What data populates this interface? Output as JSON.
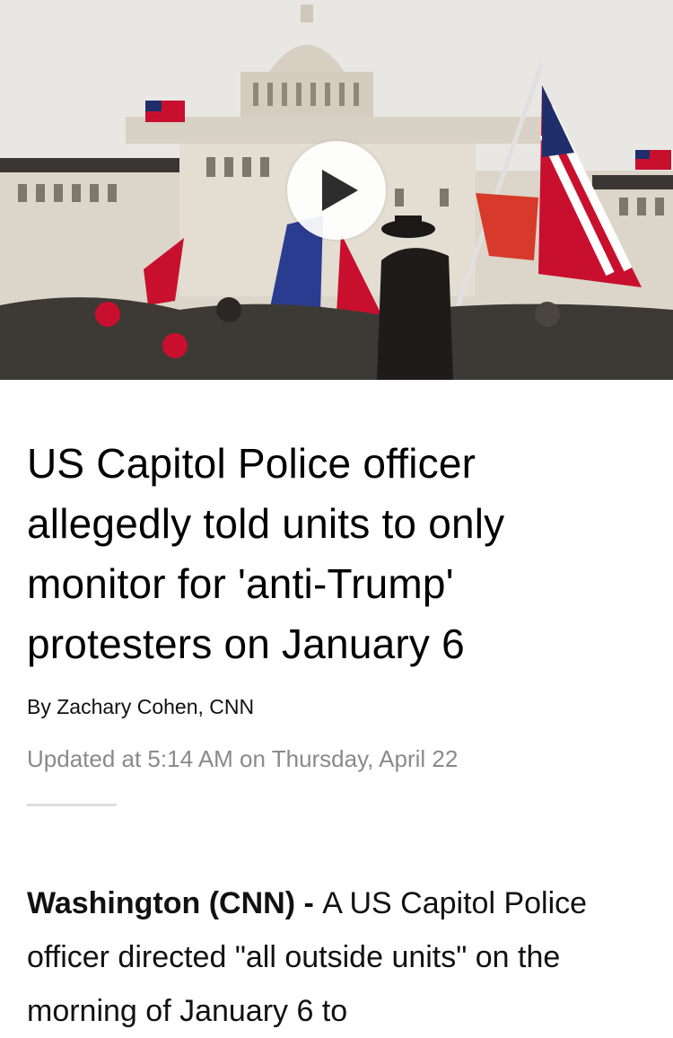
{
  "hero": {
    "image_label": "Capitol crowd photo",
    "play_icon": "play-icon"
  },
  "article": {
    "headline": "US Capitol Police officer allegedly told units to only monitor for 'anti-Trump' protesters on January 6",
    "byline": "By Zachary Cohen, CNN",
    "timestamp": "Updated at 5:14 AM on Thursday, April 22",
    "dateline": "Washington  (CNN) - ",
    "body": "A US Capitol Police officer directed \"all outside units\" on the morning of January 6 to"
  },
  "colors": {
    "sky": "#e9e7e4",
    "building": "#dcd5c9",
    "flag_red": "#c8102e",
    "flag_blue": "#1f2f6b",
    "divider": "#dedede",
    "timestamp": "#8a8a8a"
  }
}
